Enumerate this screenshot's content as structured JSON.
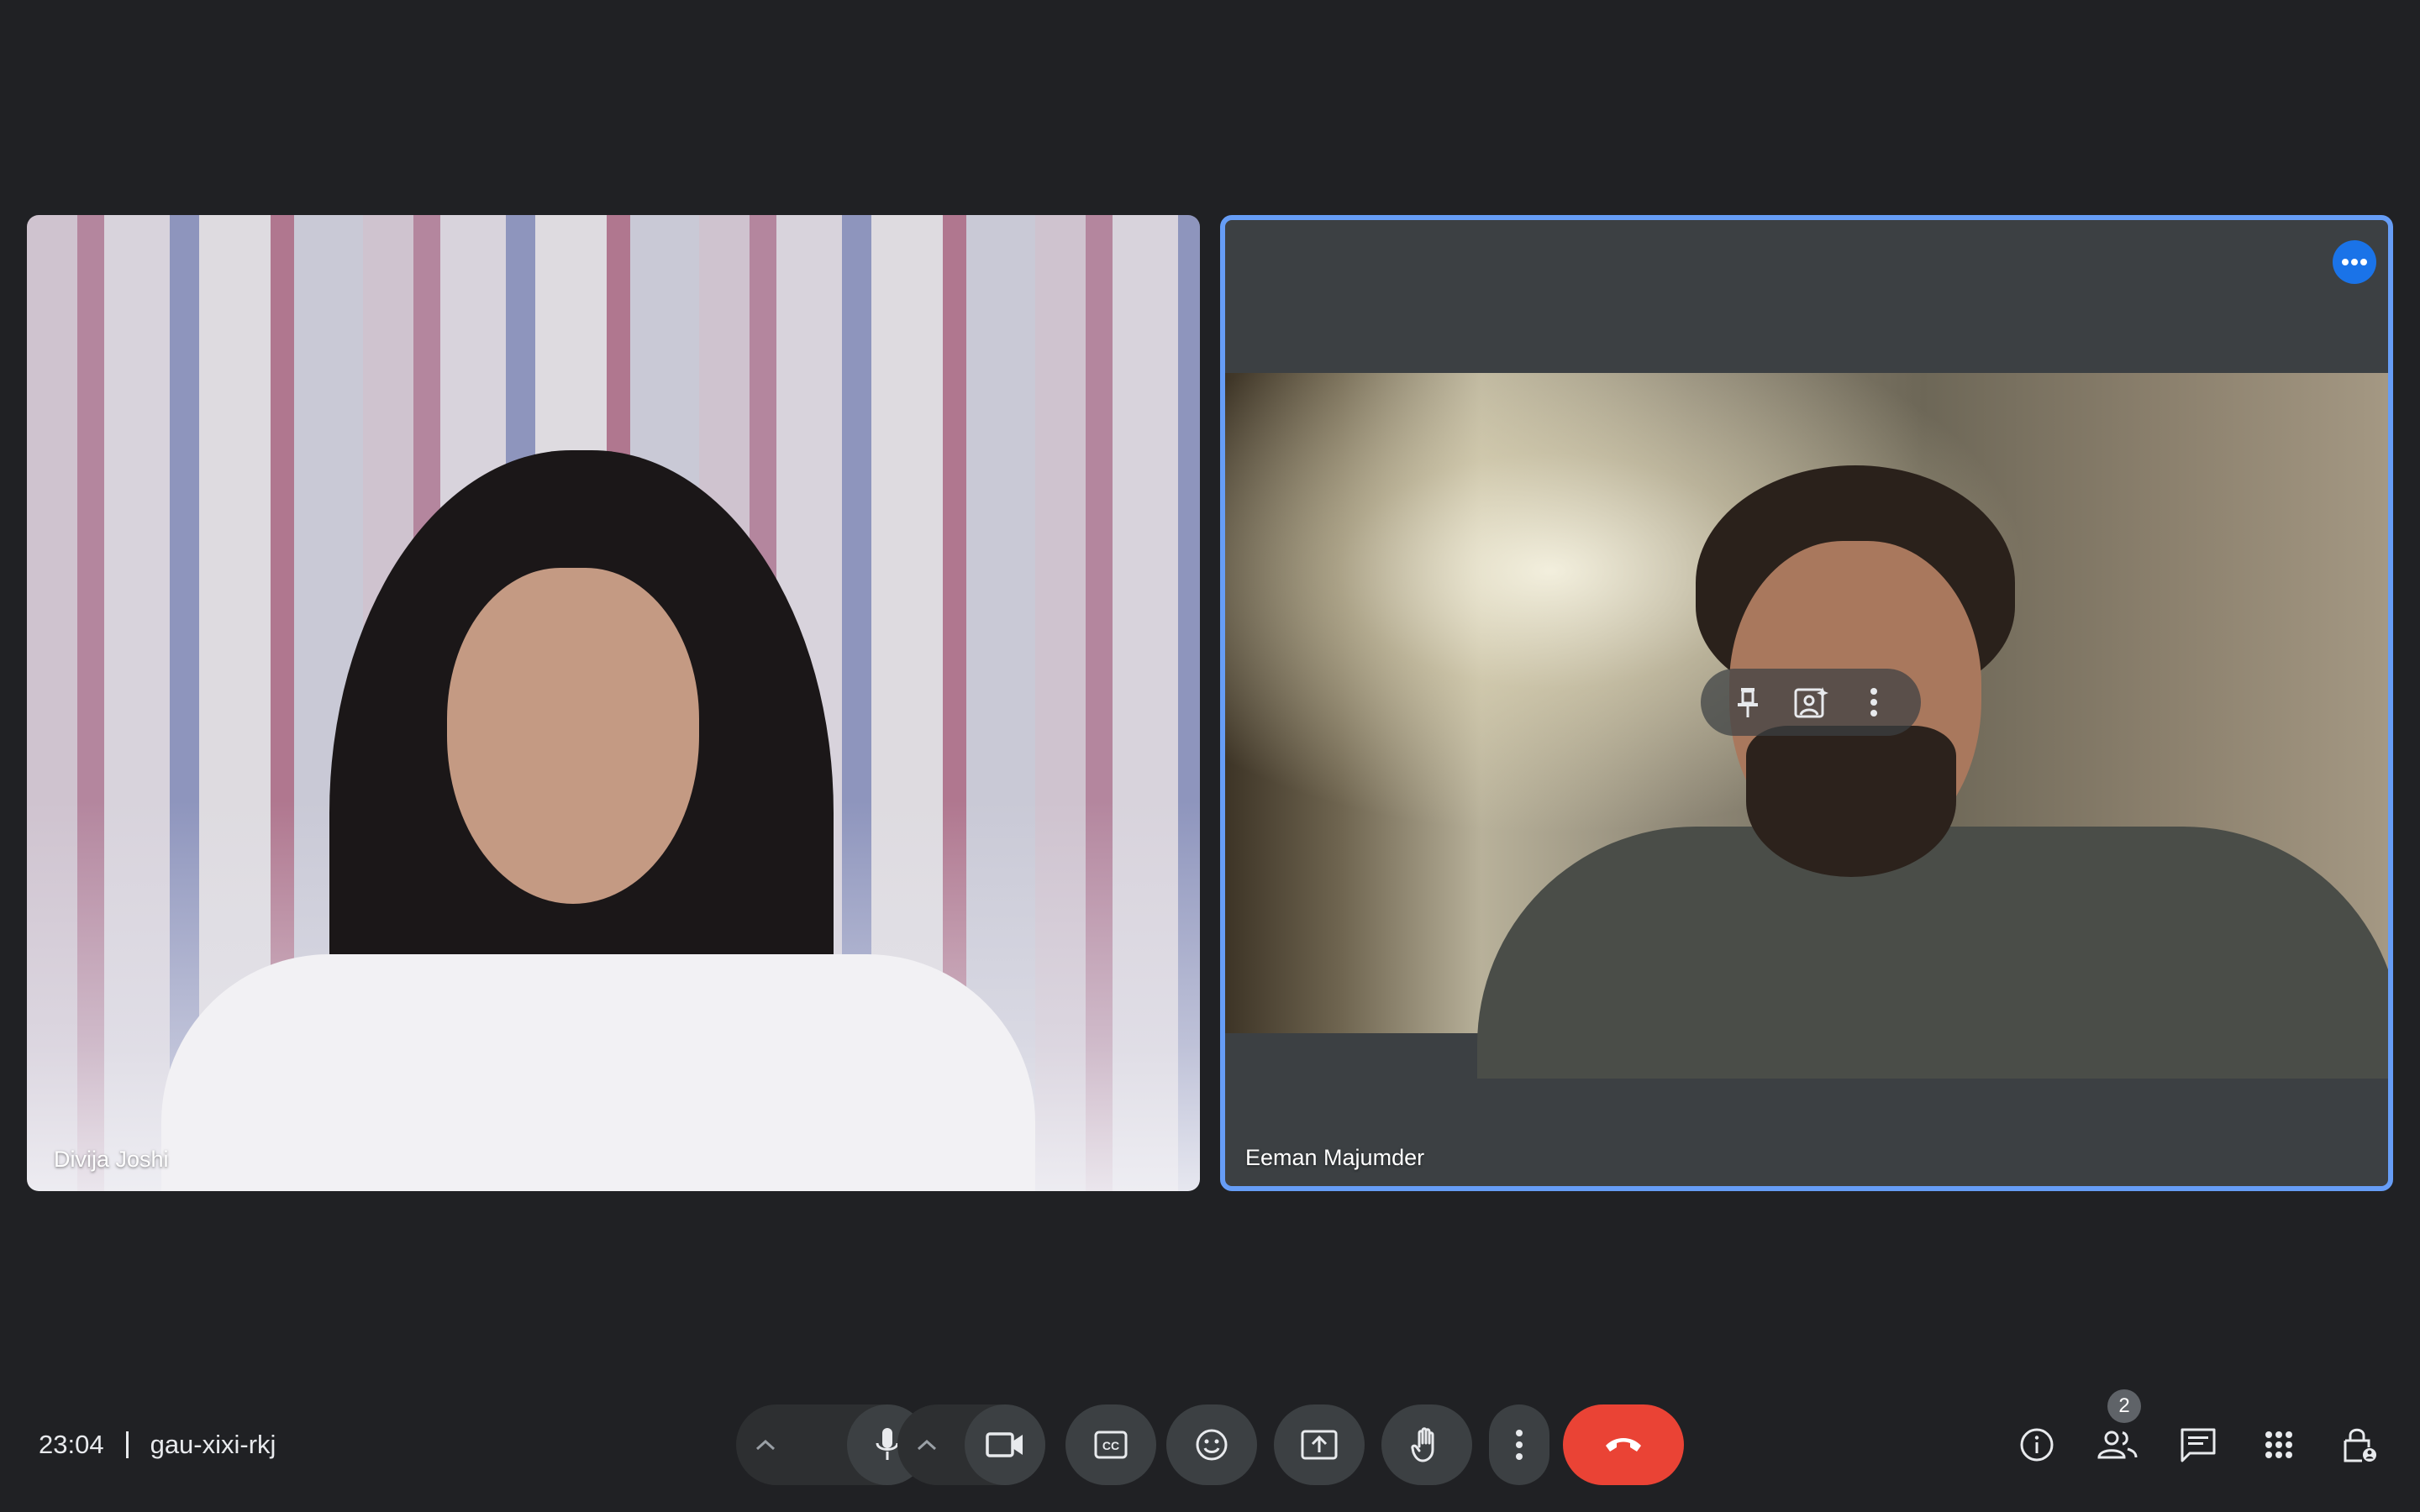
{
  "meeting": {
    "time": "23:04",
    "code": "gau-xixi-rkj"
  },
  "participants": [
    {
      "name": "Divija Joshi"
    },
    {
      "name": "Eeman Majumder"
    }
  ],
  "tile_overlay": {
    "pin_icon": "pin-icon",
    "visual_effects_icon": "visual-effects-icon",
    "more_icon": "more-vert-icon"
  },
  "controls": {
    "mic_icon": "mic-icon",
    "camera_icon": "videocam-icon",
    "captions_icon": "closed-caption-icon",
    "reactions_icon": "emoji-icon",
    "present_icon": "present-screen-icon",
    "raise_hand_icon": "hand-icon",
    "more_icon": "more-vert-icon",
    "leave_icon": "call-end-icon"
  },
  "right_panel": {
    "people_count": "2",
    "icons": [
      "info-icon",
      "people-icon",
      "chat-icon",
      "activities-icon",
      "host-controls-icon"
    ]
  },
  "colors": {
    "background": "#202124",
    "button": "#3c4043",
    "end_call": "#ea4335",
    "active_speaker_border": "#669df6",
    "accent": "#1a73e8"
  }
}
